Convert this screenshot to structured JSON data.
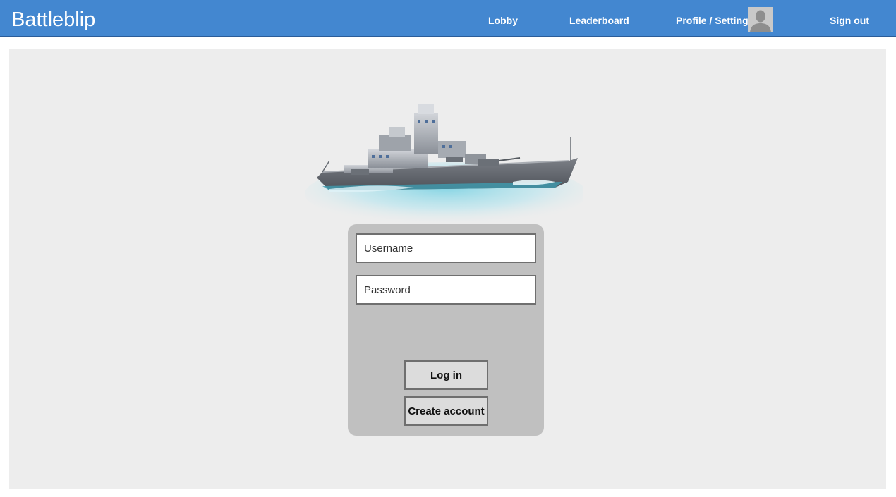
{
  "app": {
    "brand": "Battleblip"
  },
  "nav": {
    "lobby": "Lobby",
    "leaderboard": "Leaderboard",
    "profile": "Profile / Settings",
    "signout": "Sign out"
  },
  "login": {
    "username_placeholder": "Username",
    "password_placeholder": "Password",
    "login_label": "Log in",
    "create_label": "Create account"
  },
  "colors": {
    "navbar": "#4387d0",
    "panel": "#ededed",
    "card": "#c0c0c0"
  },
  "icons": {
    "avatar": "user-silhouette-icon",
    "hero": "battleship-image"
  }
}
